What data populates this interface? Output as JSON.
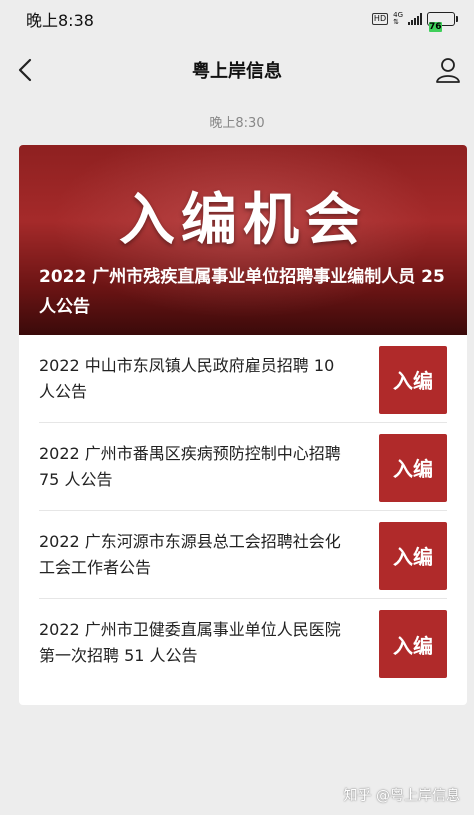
{
  "statusbar": {
    "time": "晚上8:38",
    "hd": "HD",
    "network": "4G",
    "battery": "76"
  },
  "navbar": {
    "title": "粤上岸信息"
  },
  "timestamp": "晚上8:30",
  "hero": {
    "big_text": "入编机会",
    "headline": "2022 广州市残疾直属事业单位招聘事业编制人员 25 人公告"
  },
  "items": [
    {
      "text": "2022 中山市东凤镇人民政府雇员招聘 10 人公告",
      "thumb": "入编"
    },
    {
      "text": "2022 广州市番禺区疾病预防控制中心招聘 75 人公告",
      "thumb": "入编"
    },
    {
      "text": "2022 广东河源市东源县总工会招聘社会化工会工作者公告",
      "thumb": "入编"
    },
    {
      "text": "2022 广州市卫健委直属事业单位人民医院第一次招聘 51 人公告",
      "thumb": "入编"
    }
  ],
  "watermark": "知乎 @粤上岸信息"
}
